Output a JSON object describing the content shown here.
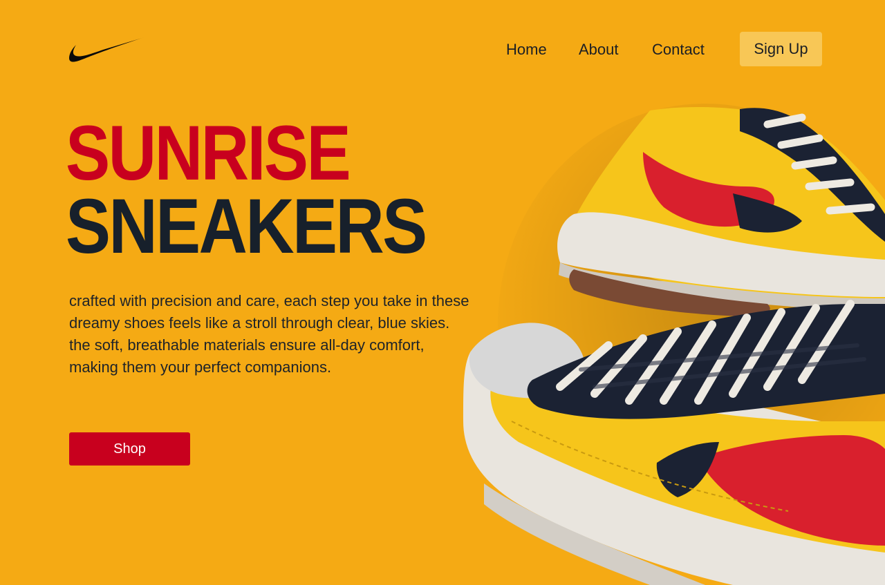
{
  "header": {
    "logo": "nike-swoosh-logo",
    "nav": {
      "home": "Home",
      "about": "About",
      "contact": "Contact"
    },
    "signup_label": "Sign Up"
  },
  "hero": {
    "headline_line1": "SUNRISE",
    "headline_line2": "SNEAKERS",
    "description": "crafted with precision and care, each step you take in these dreamy shoes feels like a stroll through clear, blue skies. the soft, breathable materials ensure all-day comfort, making them your perfect companions.",
    "shop_label": "Shop",
    "image": "sneaker-pair-image"
  },
  "colors": {
    "background": "#f5aa14",
    "accent_red": "#c8001e",
    "dark_text": "#17202b",
    "signup_button": "#f8c756",
    "shoe_yellow": "#f6c51b",
    "shoe_navy": "#1b2233",
    "shoe_white": "#e9e5de"
  }
}
